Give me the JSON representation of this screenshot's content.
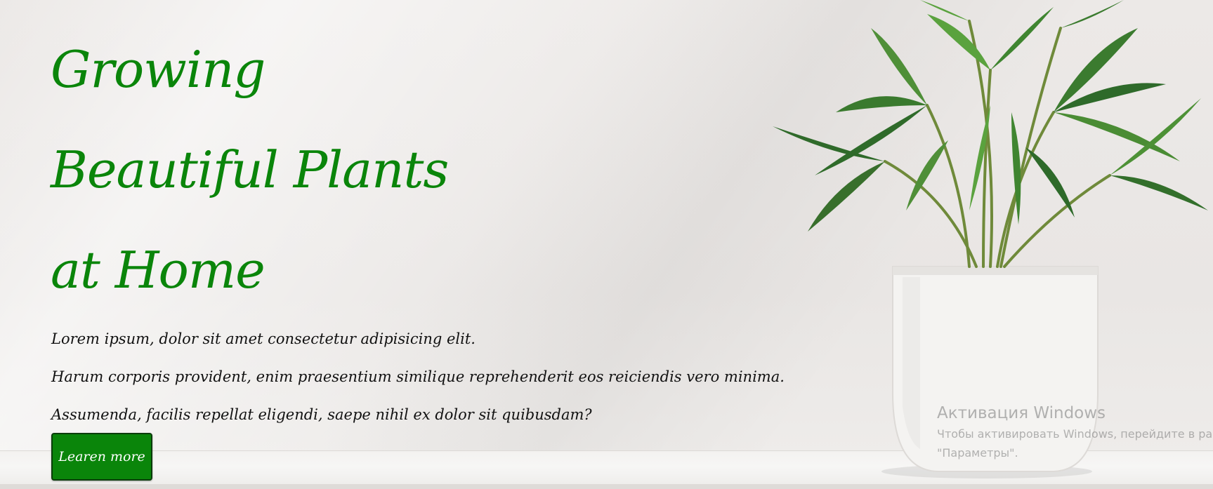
{
  "hero": {
    "headline_lines": [
      "Growing",
      "Beautiful Plants",
      "at Home"
    ],
    "paragraph_lines": [
      "Lorem ipsum, dolor sit amet consectetur adipisicing elit.",
      "Harum corporis provident, enim praesentium similique reprehenderit eos reiciendis vero minima.",
      "Assumenda, facilis repellat eligendi, saepe nihil ex dolor sit quibusdam?"
    ],
    "cta_label": "Learen more",
    "accent_color": "#0a850a"
  },
  "windows_watermark": {
    "title": "Активация Windows",
    "line1": "Чтобы активировать Windows, перейдите в раз",
    "line2": "\"Параметры\"."
  },
  "image": {
    "subject": "potted-palm-plant"
  }
}
